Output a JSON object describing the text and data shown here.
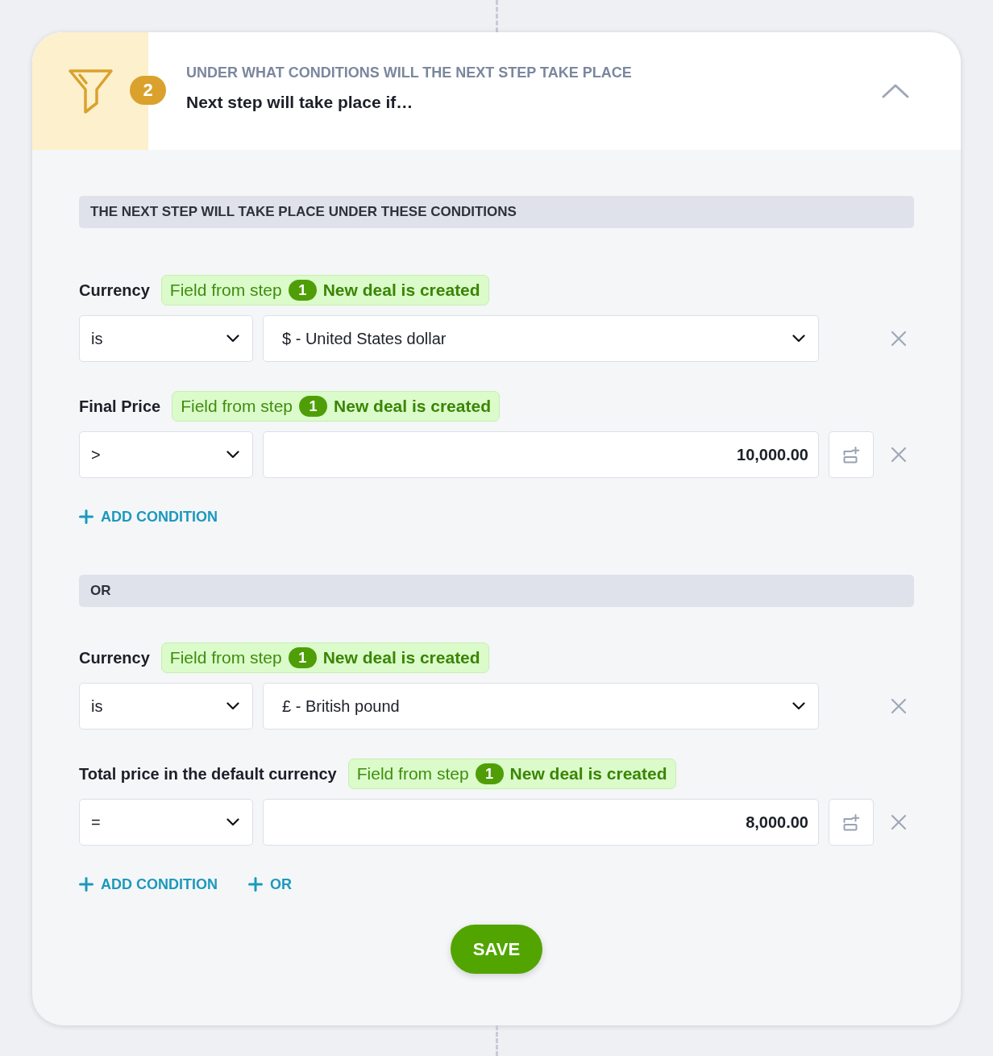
{
  "step": {
    "number": "2",
    "subtitle": "UNDER WHAT CONDITIONS WILL THE NEXT STEP TAKE PLACE",
    "title": "Next step will take place if…",
    "expanded": true
  },
  "groups": [
    {
      "heading": "THE NEXT STEP WILL TAKE PLACE UNDER THESE CONDITIONS",
      "conditions": [
        {
          "kind": "select",
          "field": "Currency",
          "source": {
            "prefix": "Field from step",
            "step": "1",
            "name": "New deal is created"
          },
          "operator": "is",
          "value": "$ - United States dollar"
        },
        {
          "kind": "number",
          "field": "Final Price",
          "source": {
            "prefix": "Field from step",
            "step": "1",
            "name": "New deal is created"
          },
          "operator": ">",
          "value": "10,000.00"
        }
      ],
      "actions": [
        {
          "label": "ADD CONDITION"
        }
      ]
    },
    {
      "heading": "OR",
      "conditions": [
        {
          "kind": "select",
          "field": "Currency",
          "source": {
            "prefix": "Field from step",
            "step": "1",
            "name": "New deal is created"
          },
          "operator": "is",
          "value": "£ - British pound"
        },
        {
          "kind": "number",
          "field": "Total price in the default currency",
          "source": {
            "prefix": "Field from step",
            "step": "1",
            "name": "New deal is created"
          },
          "operator": "=",
          "value": "8,000.00"
        }
      ],
      "actions": [
        {
          "label": "ADD CONDITION"
        },
        {
          "label": "OR"
        }
      ]
    }
  ],
  "save_button": {
    "label": "SAVE"
  }
}
